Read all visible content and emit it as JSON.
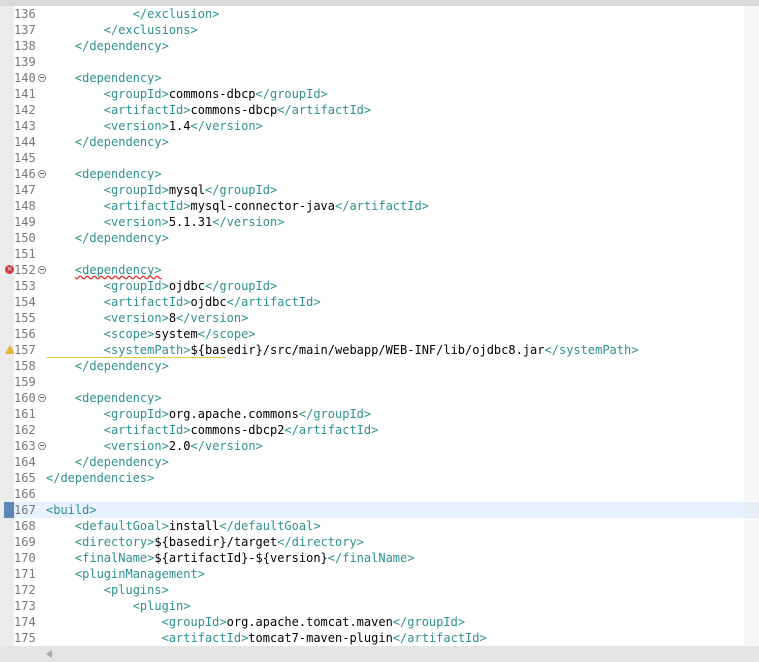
{
  "editor": {
    "lines": [
      {
        "num": "136",
        "indent": 3,
        "parts": [
          [
            "tag",
            "</exclusion>"
          ]
        ]
      },
      {
        "num": "137",
        "indent": 2,
        "parts": [
          [
            "tag",
            "</exclusions>"
          ]
        ]
      },
      {
        "num": "138",
        "indent": 1,
        "parts": [
          [
            "tag",
            "</dependency>"
          ]
        ]
      },
      {
        "num": "139",
        "indent": 0,
        "parts": []
      },
      {
        "num": "140",
        "indent": 1,
        "fold": true,
        "parts": [
          [
            "tag",
            "<dependency>"
          ]
        ]
      },
      {
        "num": "141",
        "indent": 2,
        "parts": [
          [
            "tag",
            "<groupId>"
          ],
          [
            "txt",
            "commons-dbcp"
          ],
          [
            "tag",
            "</groupId>"
          ]
        ]
      },
      {
        "num": "142",
        "indent": 2,
        "parts": [
          [
            "tag",
            "<artifactId>"
          ],
          [
            "txt",
            "commons-dbcp"
          ],
          [
            "tag",
            "</artifactId>"
          ]
        ]
      },
      {
        "num": "143",
        "indent": 2,
        "parts": [
          [
            "tag",
            "<version>"
          ],
          [
            "txt",
            "1.4"
          ],
          [
            "tag",
            "</version>"
          ]
        ]
      },
      {
        "num": "144",
        "indent": 1,
        "parts": [
          [
            "tag",
            "</dependency>"
          ]
        ]
      },
      {
        "num": "145",
        "indent": 0,
        "parts": []
      },
      {
        "num": "146",
        "indent": 1,
        "fold": true,
        "parts": [
          [
            "tag",
            "<dependency>"
          ]
        ]
      },
      {
        "num": "147",
        "indent": 2,
        "parts": [
          [
            "tag",
            "<groupId>"
          ],
          [
            "txt",
            "mysql"
          ],
          [
            "tag",
            "</groupId>"
          ]
        ]
      },
      {
        "num": "148",
        "indent": 2,
        "parts": [
          [
            "tag",
            "<artifactId>"
          ],
          [
            "txt",
            "mysql-connector-java"
          ],
          [
            "tag",
            "</artifactId>"
          ]
        ]
      },
      {
        "num": "149",
        "indent": 2,
        "parts": [
          [
            "tag",
            "<version>"
          ],
          [
            "txt",
            "5.1.31"
          ],
          [
            "tag",
            "</version>"
          ]
        ]
      },
      {
        "num": "150",
        "indent": 1,
        "parts": [
          [
            "tag",
            "</dependency>"
          ]
        ]
      },
      {
        "num": "151",
        "indent": 0,
        "parts": []
      },
      {
        "num": "152",
        "indent": 1,
        "fold": true,
        "marker": "error",
        "parts": [
          [
            "tag err",
            "<dependency>"
          ]
        ]
      },
      {
        "num": "153",
        "indent": 2,
        "parts": [
          [
            "tag",
            "<groupId>"
          ],
          [
            "txt",
            "ojdbc"
          ],
          [
            "tag",
            "</groupId>"
          ]
        ]
      },
      {
        "num": "154",
        "indent": 2,
        "parts": [
          [
            "tag",
            "<artifactId>"
          ],
          [
            "txt",
            "ojdbc"
          ],
          [
            "tag",
            "</artifactId>"
          ]
        ]
      },
      {
        "num": "155",
        "indent": 2,
        "parts": [
          [
            "tag",
            "<version>"
          ],
          [
            "txt",
            "8"
          ],
          [
            "tag",
            "</version>"
          ]
        ]
      },
      {
        "num": "156",
        "indent": 2,
        "parts": [
          [
            "tag",
            "<scope>"
          ],
          [
            "txt",
            "system"
          ],
          [
            "tag",
            "</scope>"
          ]
        ]
      },
      {
        "num": "157",
        "indent": 2,
        "marker": "warning",
        "parts": [
          [
            "tag",
            "<systemPath>"
          ],
          [
            "txt",
            "${basedir}/src/main/webapp/WEB-INF/lib/ojdbc8.jar"
          ],
          [
            "tag",
            "</systemPath>"
          ]
        ]
      },
      {
        "num": "158",
        "indent": 1,
        "parts": [
          [
            "tag",
            "</dependency>"
          ]
        ]
      },
      {
        "num": "159",
        "indent": 0,
        "parts": []
      },
      {
        "num": "160",
        "indent": 1,
        "fold": true,
        "parts": [
          [
            "tag",
            "<dependency>"
          ]
        ]
      },
      {
        "num": "161",
        "indent": 2,
        "parts": [
          [
            "tag",
            "<groupId>"
          ],
          [
            "txt",
            "org.apache.commons"
          ],
          [
            "tag",
            "</groupId>"
          ]
        ]
      },
      {
        "num": "162",
        "indent": 2,
        "parts": [
          [
            "tag",
            "<artifactId>"
          ],
          [
            "txt",
            "commons-dbcp2"
          ],
          [
            "tag",
            "</artifactId>"
          ]
        ]
      },
      {
        "num": "163",
        "indent": 2,
        "fold": true,
        "parts": [
          [
            "tag",
            "<version>"
          ],
          [
            "txt",
            "2.0"
          ],
          [
            "tag",
            "</version>"
          ]
        ]
      },
      {
        "num": "164",
        "indent": 1,
        "parts": [
          [
            "tag",
            "</dependency>"
          ]
        ]
      },
      {
        "num": "165",
        "indent": 0,
        "parts": [
          [
            "tag",
            "</dependencies>"
          ]
        ]
      },
      {
        "num": "166",
        "indent": 0,
        "parts": []
      },
      {
        "num": "167",
        "indent": 0,
        "current": true,
        "parts": [
          [
            "tag",
            "<build>"
          ]
        ]
      },
      {
        "num": "168",
        "indent": 1,
        "parts": [
          [
            "tag",
            "<defaultGoal>"
          ],
          [
            "txt",
            "install"
          ],
          [
            "tag",
            "</defaultGoal>"
          ]
        ]
      },
      {
        "num": "169",
        "indent": 1,
        "parts": [
          [
            "tag",
            "<directory>"
          ],
          [
            "txt",
            "${basedir}/target"
          ],
          [
            "tag",
            "</directory>"
          ]
        ]
      },
      {
        "num": "170",
        "indent": 1,
        "parts": [
          [
            "tag",
            "<finalName>"
          ],
          [
            "txt",
            "${artifactId}-${version}"
          ],
          [
            "tag",
            "</finalName>"
          ]
        ]
      },
      {
        "num": "171",
        "indent": 1,
        "parts": [
          [
            "tag",
            "<pluginManagement>"
          ]
        ]
      },
      {
        "num": "172",
        "indent": 2,
        "parts": [
          [
            "tag",
            "<plugins>"
          ]
        ]
      },
      {
        "num": "173",
        "indent": 3,
        "parts": [
          [
            "tag",
            "<plugin>"
          ]
        ]
      },
      {
        "num": "174",
        "indent": 4,
        "parts": [
          [
            "tag",
            "<groupId>"
          ],
          [
            "txt",
            "org.apache.tomcat.maven"
          ],
          [
            "tag",
            "</groupId>"
          ]
        ]
      },
      {
        "num": "175",
        "indent": 4,
        "parts": [
          [
            "tag",
            "<artifactId>"
          ],
          [
            "txt",
            "tomcat7-maven-plugin"
          ],
          [
            "tag",
            "</artifactId>"
          ]
        ]
      }
    ]
  },
  "colors": {
    "tag": "#2f8f8f",
    "text": "#000000",
    "line_number": "#787878",
    "current_line": "#e8f2fe",
    "error": "#d23b3b",
    "warning": "#e5b43b"
  },
  "icons": {
    "error_marker": "error-icon",
    "warning_marker": "warning-icon",
    "fold_toggle": "collapse-icon",
    "scroll_left": "chevron-left-icon"
  }
}
